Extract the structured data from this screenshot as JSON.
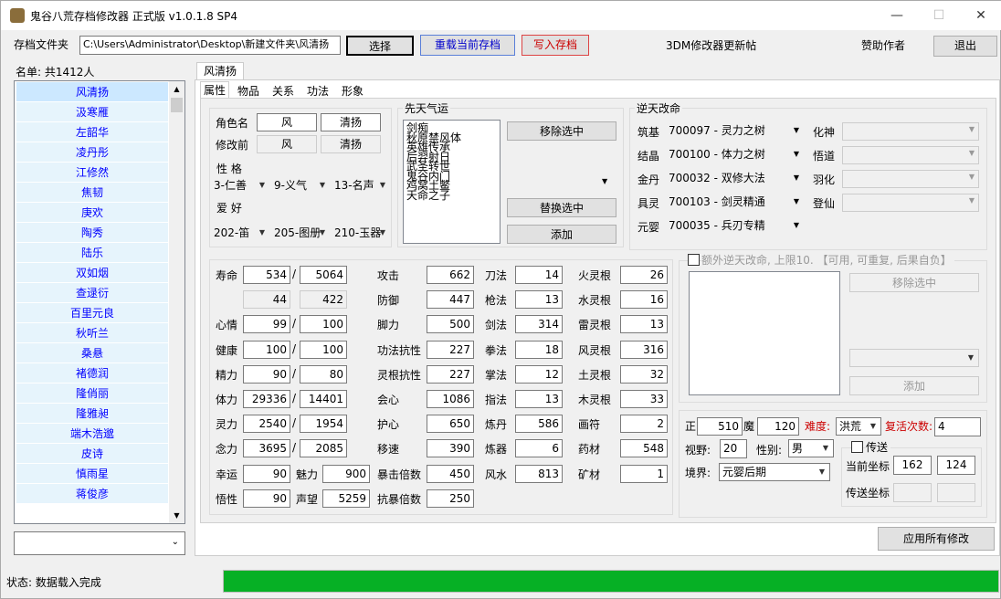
{
  "window": {
    "title": "鬼谷八荒存档修改器 正式版 v1.0.1.8 SP4",
    "minimize": "—",
    "maximize": "☐",
    "close": "✕"
  },
  "toolbar": {
    "save_folder_label": "存档文件夹",
    "save_path": "C:\\Users\\Administrator\\Desktop\\新建文件夹\\风清扬",
    "select": "选择",
    "reload": "重载当前存档",
    "write": "写入存档",
    "forum": "3DM修改器更新帖",
    "sponsor": "赞助作者",
    "exit": "退出"
  },
  "roster": {
    "header": "名单: 共1412人",
    "names": [
      "风清扬",
      "汲寒雁",
      "左韶华",
      "凌丹彤",
      "江修然",
      "焦韧",
      "庚欢",
      "陶秀",
      "陆乐",
      "双如烟",
      "查逯衍",
      "百里元良",
      "秋听兰",
      "桑悬",
      "褚德润",
      "隆俏丽",
      "隆雅昶",
      "端木浩邈",
      "皮诗",
      "慎雨星",
      "蒋俊彦"
    ]
  },
  "char_tab": "风清扬",
  "tabs": [
    "属性",
    "物品",
    "关系",
    "功法",
    "形象"
  ],
  "name": {
    "label": "角色名",
    "surname": "风",
    "given": "清扬",
    "prev_label": "修改前",
    "prev_surname": "风",
    "prev_given": "清扬"
  },
  "personality": {
    "label": "性 格",
    "v1": "3-仁善",
    "v2": "9-义气",
    "v3": "13-名声"
  },
  "hobby": {
    "label": "爱 好",
    "v1": "202-笛",
    "v2": "205-图册",
    "v3": "210-玉器"
  },
  "innate": {
    "title": "先天气运",
    "items": [
      "剑痴",
      "秋原禁风体",
      "英雄传承",
      "后羿射日",
      "武圣转世",
      "鬼谷内门",
      "鸡窝土鳖",
      "天命之子"
    ],
    "remove": "移除选中",
    "replace": "替换选中",
    "add": "添加"
  },
  "destiny": {
    "title": "逆天改命",
    "rows": [
      {
        "stage": "筑基",
        "code": "700097 - 灵力之树"
      },
      {
        "stage": "结晶",
        "code": "700100 - 体力之树"
      },
      {
        "stage": "金丹",
        "code": "700032 - 双修大法"
      },
      {
        "stage": "具灵",
        "code": "700103 - 剑灵精通"
      },
      {
        "stage": "元婴",
        "code": "700035 - 兵刃专精"
      }
    ],
    "right": [
      "化神",
      "悟道",
      "羽化",
      "登仙"
    ]
  },
  "extra": {
    "label": "额外逆天改命, 上限10. 【可用, 可重复, 后果自负】",
    "remove": "移除选中",
    "add": "添加"
  },
  "stats": {
    "life": {
      "label": "寿命",
      "a": "534",
      "b": "5064",
      "c": "44",
      "d": "422"
    },
    "mood": {
      "label": "心情",
      "a": "99",
      "b": "100"
    },
    "health": {
      "label": "健康",
      "a": "100",
      "b": "100"
    },
    "energy": {
      "label": "精力",
      "a": "90",
      "b": "80"
    },
    "hp": {
      "label": "体力",
      "a": "29336",
      "b": "14401"
    },
    "mp": {
      "label": "灵力",
      "a": "2540",
      "b": "1954"
    },
    "mind": {
      "label": "念力",
      "a": "3695",
      "b": "2085"
    },
    "luck": {
      "label": "幸运",
      "a": "90"
    },
    "charm": {
      "label": "魅力",
      "a": "900"
    },
    "wit": {
      "label": "悟性",
      "a": "90"
    },
    "fame": {
      "label": "声望",
      "a": "5259"
    },
    "col2": [
      [
        "攻击",
        "662"
      ],
      [
        "防御",
        "447"
      ],
      [
        "脚力",
        "500"
      ],
      [
        "功法抗性",
        "227"
      ],
      [
        "灵根抗性",
        "227"
      ],
      [
        "会心",
        "1086"
      ],
      [
        "护心",
        "650"
      ],
      [
        "移速",
        "390"
      ],
      [
        "暴击倍数",
        "450"
      ],
      [
        "抗暴倍数",
        "250"
      ]
    ],
    "col3": [
      [
        "刀法",
        "14"
      ],
      [
        "枪法",
        "13"
      ],
      [
        "剑法",
        "314"
      ],
      [
        "拳法",
        "18"
      ],
      [
        "掌法",
        "12"
      ],
      [
        "指法",
        "13"
      ],
      [
        "炼丹",
        "586"
      ],
      [
        "炼器",
        "6"
      ],
      [
        "风水",
        "813"
      ]
    ],
    "col4": [
      [
        "火灵根",
        "26"
      ],
      [
        "水灵根",
        "16"
      ],
      [
        "雷灵根",
        "13"
      ],
      [
        "风灵根",
        "316"
      ],
      [
        "土灵根",
        "32"
      ],
      [
        "木灵根",
        "33"
      ],
      [
        "画符",
        "2"
      ],
      [
        "药材",
        "548"
      ],
      [
        "矿材",
        "1"
      ]
    ]
  },
  "misc": {
    "zheng_label": "正",
    "zheng": "510",
    "mo_label": "魔",
    "mo": "120",
    "difficulty_label": "难度:",
    "difficulty": "洪荒",
    "revive_label": "复活次数:",
    "revive": "4",
    "vision_label": "视野:",
    "vision": "20",
    "gender_label": "性别:",
    "gender": "男",
    "realm_label": "境界:",
    "realm": "元婴后期",
    "teleport_label": "传送",
    "cur_label": "当前坐标",
    "cur_x": "162",
    "cur_y": "124",
    "tp_label": "传送坐标"
  },
  "apply": "应用所有修改",
  "status": "状态: 数据载入完成",
  "progress": 1.0
}
